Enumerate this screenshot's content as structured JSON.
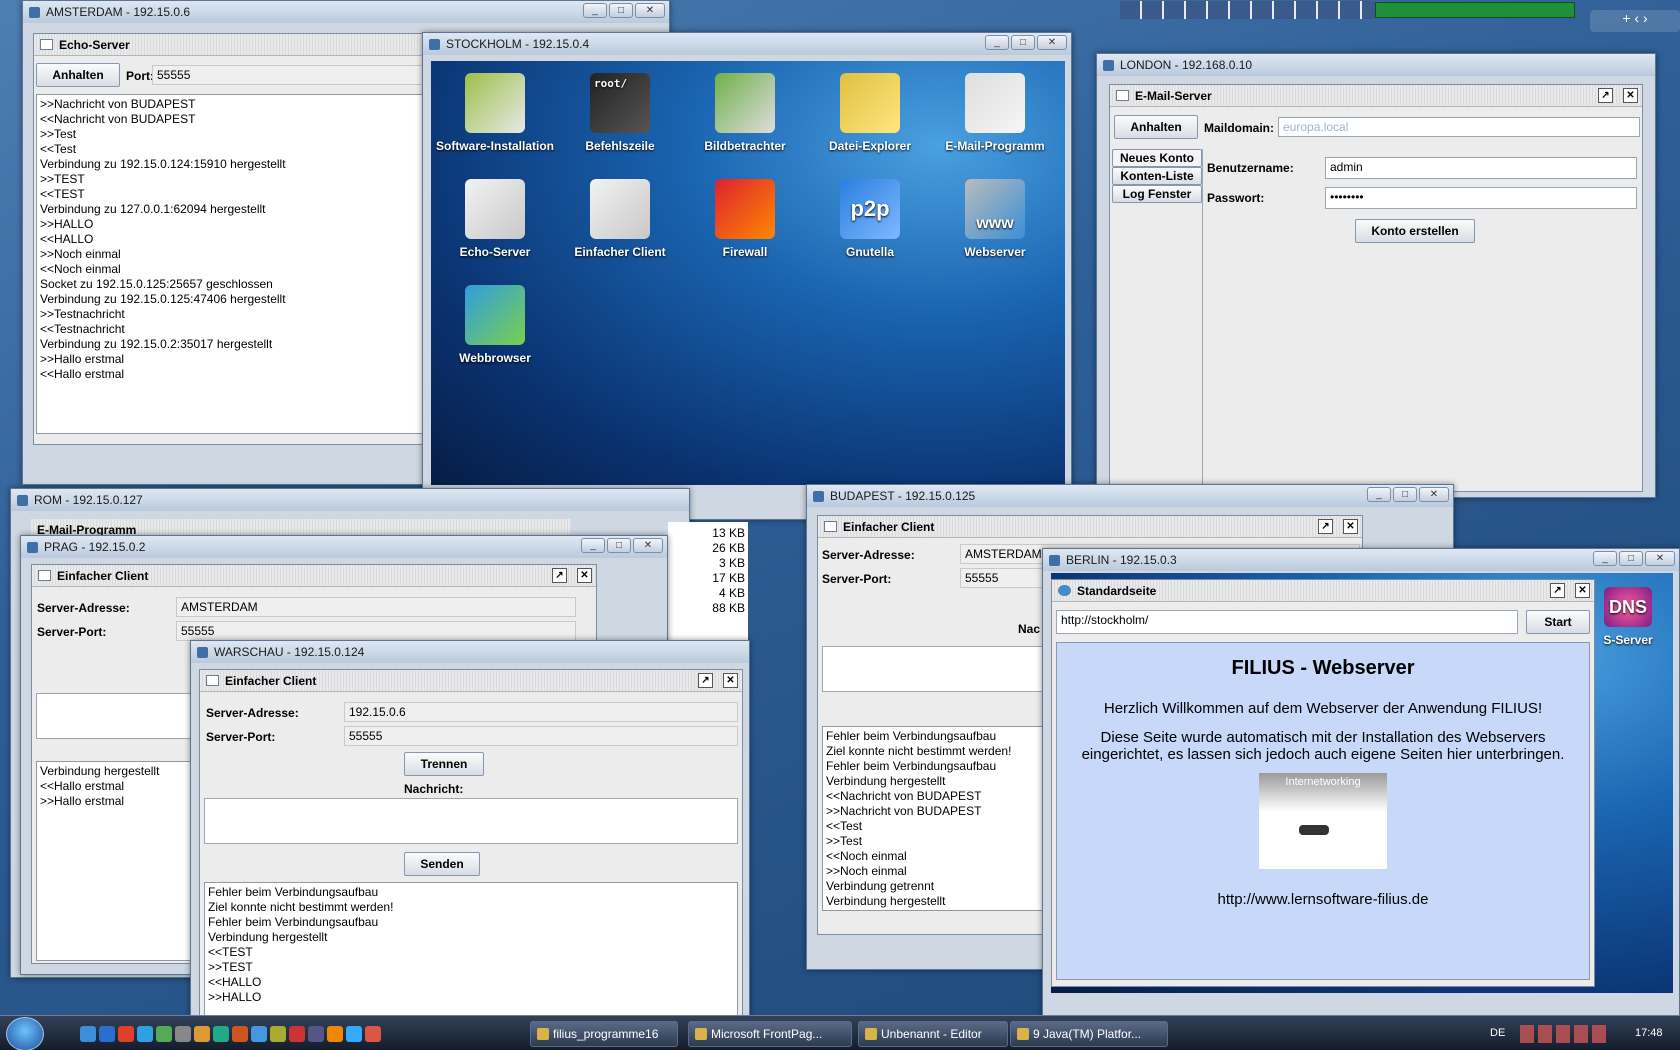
{
  "amsterdam": {
    "title": "AMSTERDAM - 192.15.0.6",
    "app": "Echo-Server",
    "button": "Anhalten",
    "port_label": "Port:",
    "port": "55555",
    "log": [
      ">>Nachricht von BUDAPEST",
      "<<Nachricht von BUDAPEST",
      ">>Test",
      "<<Test",
      "Verbindung zu 192.15.0.124:15910 hergestellt",
      ">>TEST",
      "<<TEST",
      "Verbindung zu 127.0.0.1:62094 hergestellt",
      ">>HALLO",
      "<<HALLO",
      ">>Noch einmal",
      "<<Noch einmal",
      "Socket zu 192.15.0.125:25657 geschlossen",
      "Verbindung zu 192.15.0.125:47406 hergestellt",
      ">>Testnachricht",
      "<<Testnachricht",
      "Verbindung zu 192.15.0.2:35017 hergestellt",
      ">>Hallo erstmal",
      "<<Hallo erstmal"
    ]
  },
  "stockholm": {
    "title": "STOCKHOLM - 192.15.0.4",
    "icons": [
      "Software-Installation",
      "Befehlszeile",
      "Bildbetrachter",
      "Datei-Explorer",
      "E-Mail-Programm",
      "Echo-Server",
      "Einfacher Client",
      "Firewall",
      "Gnutella",
      "Webserver",
      "Webbrowser"
    ],
    "terminal_text": "root/",
    "p2p_text": "p2p",
    "www_text": "www"
  },
  "london": {
    "title": "LONDON - 192.168.0.10",
    "app": "E-Mail-Server",
    "button": "Anhalten",
    "maildomain_label": "Maildomain:",
    "maildomain": "europa.local",
    "tabs": [
      "Neues Konto",
      "Konten-Liste",
      "Log Fenster"
    ],
    "user_label": "Benutzername:",
    "user": "admin",
    "pass_label": "Passwort:",
    "pass": "••••••••",
    "create": "Konto erstellen"
  },
  "rom": {
    "title": "ROM - 192.15.0.127",
    "app": "E-Mail-Programm"
  },
  "sizes": [
    "13 KB",
    "26 KB",
    "3 KB",
    "17 KB",
    "4 KB",
    "88 KB"
  ],
  "prag": {
    "title": "PRAG - 192.15.0.2",
    "app": "Einfacher Client",
    "addr_label": "Server-Adresse:",
    "addr": "AMSTERDAM",
    "port_label": "Server-Port:",
    "port": "55555",
    "log": [
      "Verbindung hergestellt",
      "<<Hallo erstmal",
      ">>Hallo erstmal"
    ]
  },
  "warschau": {
    "title": "WARSCHAU - 192.15.0.124",
    "app": "Einfacher Client",
    "addr_label": "Server-Adresse:",
    "addr": "192.15.0.6",
    "port_label": "Server-Port:",
    "port": "55555",
    "disconnect": "Trennen",
    "msg_label": "Nachricht:",
    "send": "Senden",
    "log": [
      "Fehler beim Verbindungsaufbau",
      "Ziel konnte nicht bestimmt werden!",
      "Fehler beim Verbindungsaufbau",
      "Verbindung hergestellt",
      "<<TEST",
      ">>TEST",
      "<<HALLO",
      ">>HALLO"
    ],
    "behind_label": "-Program"
  },
  "budapest": {
    "title": "BUDAPEST - 192.15.0.125",
    "app": "Einfacher Client",
    "addr_label": "Server-Adresse:",
    "addr": "AMSTERDAM",
    "port_label": "Server-Port:",
    "port": "55555",
    "msg_label_partial": "Nac",
    "log": [
      "Fehler beim Verbindungsaufbau",
      "Ziel konnte nicht bestimmt werden!",
      "Fehler beim Verbindungsaufbau",
      "Verbindung hergestellt",
      "<<Nachricht von BUDAPEST",
      ">>Nachricht von BUDAPEST",
      "<<Test",
      ">>Test",
      "<<Noch einmal",
      ">>Noch einmal",
      "Verbindung getrennt",
      "Verbindung hergestellt"
    ]
  },
  "berlin": {
    "title": "BERLIN - 192.15.0.3",
    "app": "Standardseite",
    "url": "http://stockholm/",
    "start": "Start",
    "heading": "FILIUS - Webserver",
    "p1": "Herzlich Willkommen auf dem Webserver der Anwendung FILIUS!",
    "p2": "Diese Seite wurde automatisch mit der Installation des Webservers eingerichtet, es lassen sich jedoch auch eigene Seiten hier unterbringen.",
    "img_caption": "Internetworking",
    "link": "http://www.lernsoftware-filius.de",
    "dns_label": "DNS",
    "dns_sub": "S-Server"
  },
  "taskbar": {
    "buttons": [
      "filius_programme16",
      "Microsoft FrontPag...",
      "Unbenannt - Editor",
      "9 Java(TM) Platfor..."
    ],
    "lang": "DE",
    "time": "17:48"
  },
  "colors": {
    "accent": "#3f6fa6",
    "desktop": "#1a64b0",
    "browser_bg": "#c8d8f8"
  }
}
